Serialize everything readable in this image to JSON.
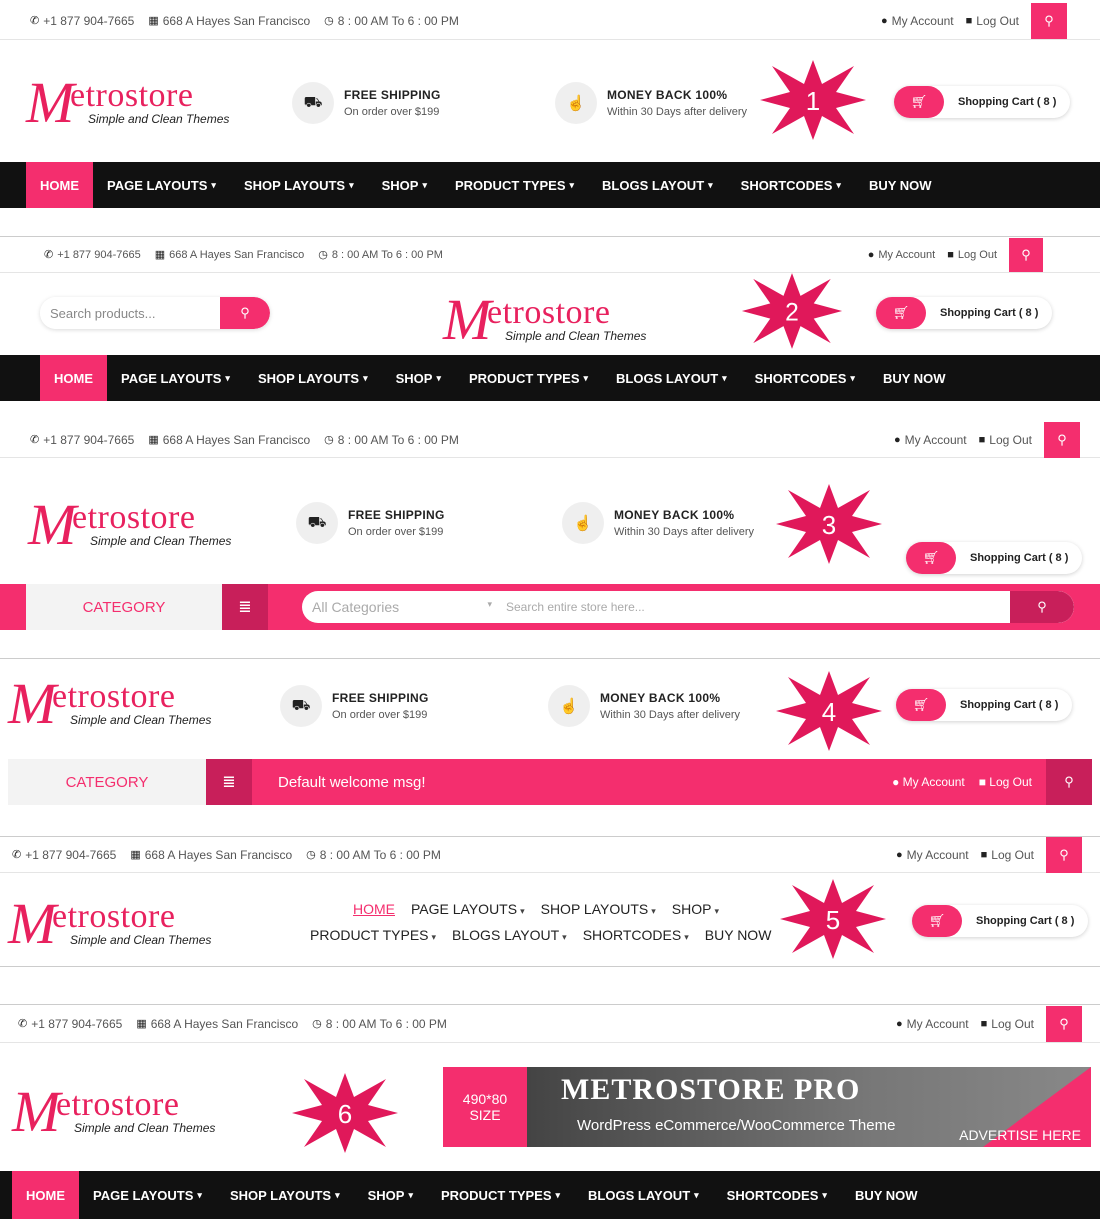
{
  "brand": {
    "logo_letter": "M",
    "logo_rest": "etrostore",
    "tagline": "Simple and Clean Themes",
    "accent": "#f42e6e"
  },
  "topbar": {
    "phone": "+1 877 904-7665",
    "address": "668 A Hayes San Francisco",
    "hours": "8 : 00 AM To 6 : 00 PM",
    "my_account": "My Account",
    "log_out": "Log Out"
  },
  "features": {
    "shipping_title": "FREE SHIPPING",
    "shipping_sub": "On order over $199",
    "money_title": "MONEY BACK 100%",
    "money_sub": "Within 30 Days after delivery"
  },
  "cart": {
    "label": "Shopping Cart ( 8 )"
  },
  "nav": {
    "home": "HOME",
    "page_layouts": "PAGE LAYOUTS",
    "shop_layouts": "SHOP LAYOUTS",
    "shop": "SHOP",
    "product_types": "PRODUCT TYPES",
    "blogs_layout": "BLOGS LAYOUT",
    "shortcodes": "SHORTCODES",
    "buy_now": "BUY NOW"
  },
  "search": {
    "products_placeholder": "Search products...",
    "all_categories": "All Categories",
    "store_placeholder": "Search entire store here..."
  },
  "category": {
    "label": "CATEGORY",
    "welcome": "Default welcome msg!"
  },
  "badges": {
    "b1": "1",
    "b2": "2",
    "b3": "3",
    "b4": "4",
    "b5": "5",
    "b6": "6"
  },
  "banner": {
    "size_line1": "490*80",
    "size_line2": "SIZE",
    "title": "METROSTORE PRO",
    "subtitle": "WordPress eCommerce/WooCommerce Theme",
    "advertise": "ADVERTISE HERE"
  },
  "icons": [
    "phone-icon",
    "map-icon",
    "clock-icon",
    "user-icon",
    "lock-icon",
    "search-icon",
    "truck-icon",
    "thumbs-up-icon",
    "cart-icon",
    "menu-icon",
    "caret-down-icon"
  ]
}
